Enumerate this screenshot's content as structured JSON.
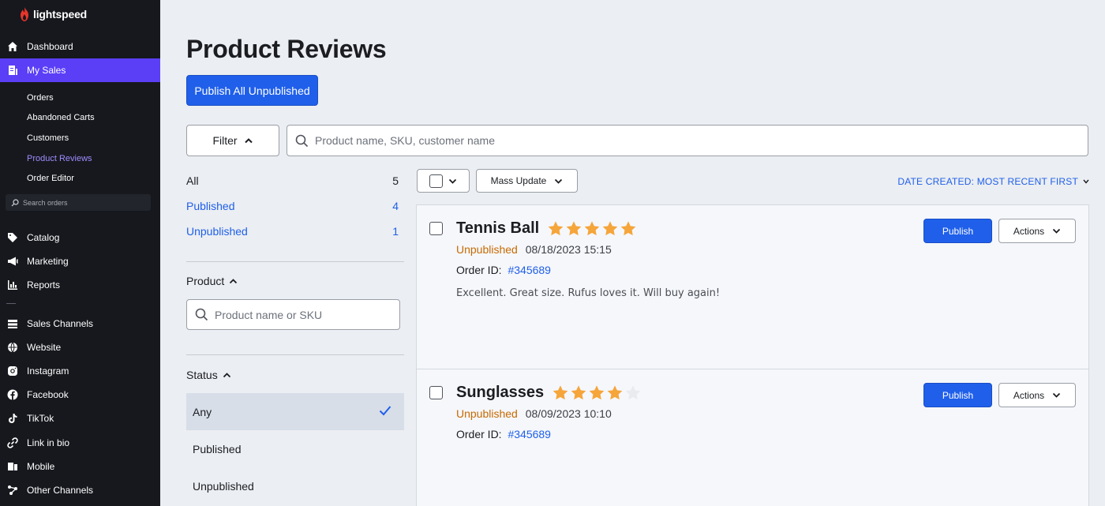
{
  "brand": {
    "name": "lightspeed",
    "color": "#e8352a"
  },
  "sidebar": {
    "items": [
      {
        "label": "Dashboard",
        "icon": "home-icon"
      },
      {
        "label": "My Sales",
        "icon": "sales-icon",
        "active": true
      },
      {
        "label": "Catalog",
        "icon": "tag-icon"
      },
      {
        "label": "Marketing",
        "icon": "megaphone-icon"
      },
      {
        "label": "Reports",
        "icon": "chart-icon"
      },
      {
        "label": "Sales Channels",
        "icon": "channels-icon"
      },
      {
        "label": "Website",
        "icon": "globe-icon"
      },
      {
        "label": "Instagram",
        "icon": "instagram-icon"
      },
      {
        "label": "Facebook",
        "icon": "facebook-icon"
      },
      {
        "label": "TikTok",
        "icon": "tiktok-icon"
      },
      {
        "label": "Link in bio",
        "icon": "link-icon"
      },
      {
        "label": "Mobile",
        "icon": "mobile-icon"
      },
      {
        "label": "Other Channels",
        "icon": "other-channels-icon"
      }
    ],
    "subitems": [
      "Orders",
      "Abandoned Carts",
      "Customers",
      "Product Reviews",
      "Order Editor"
    ],
    "active_subitem": "Product Reviews",
    "search_placeholder": "Search orders"
  },
  "page": {
    "title": "Product Reviews",
    "publish_all_label": "Publish All Unpublished",
    "filter_label": "Filter",
    "search_placeholder": "Product name, SKU, customer name"
  },
  "filters": {
    "counts": [
      {
        "label": "All",
        "count": "5"
      },
      {
        "label": "Published",
        "count": "4"
      },
      {
        "label": "Unpublished",
        "count": "1"
      }
    ],
    "product_heading": "Product",
    "product_placeholder": "Product name or SKU",
    "status_heading": "Status",
    "status_options": [
      "Any",
      "Published",
      "Unpublished"
    ],
    "selected_status": "Any"
  },
  "toolbar": {
    "mass_update_label": "Mass Update",
    "sort_label": "DATE CREATED: MOST RECENT FIRST"
  },
  "reviews": [
    {
      "product": "Tennis Ball",
      "rating": 5,
      "status": "Unpublished",
      "date": "08/18/2023 15:15",
      "order_label": "Order ID:",
      "order_id": "#345689",
      "text": "Excellent. Great size. Rufus loves it. Will buy again!",
      "publish_label": "Publish",
      "actions_label": "Actions"
    },
    {
      "product": "Sunglasses",
      "rating": 4,
      "status": "Unpublished",
      "date": "08/09/2023 10:10",
      "order_label": "Order ID:",
      "order_id": "#345689",
      "text": "",
      "publish_label": "Publish",
      "actions_label": "Actions"
    }
  ],
  "colors": {
    "accent": "#1f5fea",
    "sidebar_active": "#5a3ff7",
    "star": "#f5a53a",
    "unpublished": "#c76a00"
  }
}
